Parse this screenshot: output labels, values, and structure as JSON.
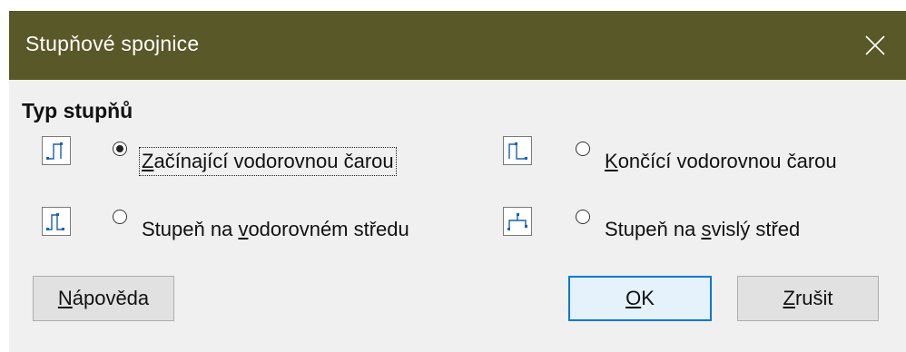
{
  "dialog": {
    "title": "Stupňové spojnice",
    "section_title": "Typ stupňů",
    "options": [
      {
        "label_pre": "",
        "label_accel": "Z",
        "label_post": "ačínající vodorovnou čarou",
        "checked": true,
        "icon": "step-start-horizontal-icon"
      },
      {
        "label_pre": "",
        "label_accel": "K",
        "label_post": "ončící vodorovnou čarou",
        "checked": false,
        "icon": "step-end-horizontal-icon"
      },
      {
        "label_pre": "Stupeň na ",
        "label_accel": "v",
        "label_post": "odorovném středu",
        "checked": false,
        "icon": "step-center-horizontal-icon"
      },
      {
        "label_pre": "Stupeň na ",
        "label_accel": "s",
        "label_post": "vislý střed",
        "checked": false,
        "icon": "step-center-vertical-icon"
      }
    ],
    "buttons": {
      "help_accel": "N",
      "help_rest": "ápověda",
      "ok_accel": "O",
      "ok_rest": "K",
      "cancel_accel": "Z",
      "cancel_rest": "rušit"
    },
    "colors": {
      "titlebar": "#585828",
      "default_button_border": "#0078d7"
    }
  }
}
